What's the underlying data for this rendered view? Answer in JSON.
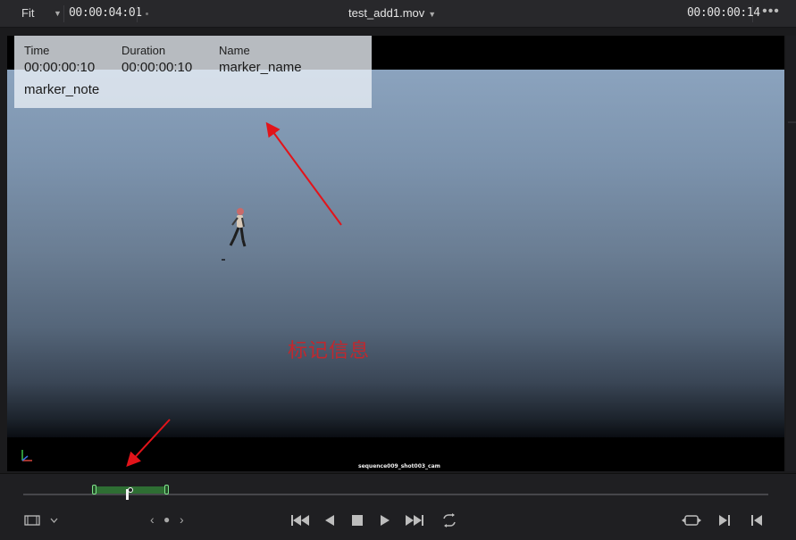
{
  "topbar": {
    "zoom": "Fit",
    "current_timecode": "00:00:04:01",
    "clip_name": "test_add1.mov",
    "duration_timecode": "00:00:00:14",
    "more": "•••"
  },
  "marker_overlay": {
    "headers": {
      "time": "Time",
      "duration": "Duration",
      "name": "Name"
    },
    "values": {
      "time": "00:00:00:10",
      "duration": "00:00:00:10",
      "name": "marker_name"
    },
    "note": "marker_note"
  },
  "viewer": {
    "annotation_text": "标记信息",
    "camera_label": "sequence009_shot003_cam"
  },
  "colors": {
    "annotation_red": "#c0282e",
    "marker_green": "#2e6e33",
    "marker_cap": "#7ee38a",
    "background": "#1b1b1d"
  },
  "icons": {
    "viewer_mode": "filmstrip-icon",
    "nav_prev": "chevron-left-icon",
    "nav_dot": "dot-icon",
    "nav_next": "chevron-right-icon",
    "first_frame": "skip-to-start-icon",
    "reverse": "play-reverse-icon",
    "stop": "stop-icon",
    "play": "play-icon",
    "last_frame": "skip-to-end-icon",
    "loop": "loop-icon",
    "match_frame": "match-frame-icon",
    "next_edit": "next-edit-icon",
    "prev_edit": "prev-edit-icon"
  }
}
